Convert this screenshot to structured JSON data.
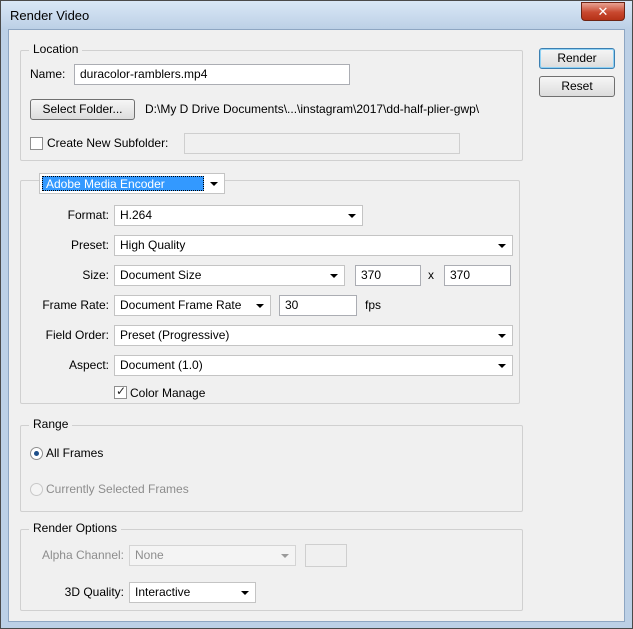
{
  "window": {
    "title": "Render Video",
    "close_glyph": "✕"
  },
  "buttons": {
    "render": "Render",
    "reset": "Reset",
    "select_folder": "Select Folder..."
  },
  "location": {
    "legend": "Location",
    "name_label": "Name:",
    "name_value": "duracolor-ramblers.mp4",
    "folder_path": "D:\\My D Drive Documents\\...\\instagram\\2017\\dd-half-plier-gwp\\",
    "create_subfolder_label": "Create New Subfolder:",
    "create_subfolder_checked": false,
    "subfolder_value": ""
  },
  "encoder": {
    "selected": "Adobe Media Encoder",
    "format_label": "Format:",
    "format_value": "H.264",
    "preset_label": "Preset:",
    "preset_value": "High Quality",
    "size_label": "Size:",
    "size_value": "Document Size",
    "width": "370",
    "size_x": "x",
    "height": "370",
    "frame_rate_label": "Frame Rate:",
    "frame_rate_value": "Document Frame Rate",
    "fps_value": "30",
    "fps_label": "fps",
    "field_order_label": "Field Order:",
    "field_order_value": "Preset (Progressive)",
    "aspect_label": "Aspect:",
    "aspect_value": "Document (1.0)",
    "color_manage_label": "Color Manage",
    "color_manage_checked": true
  },
  "range": {
    "legend": "Range",
    "all_frames": "All Frames",
    "selected_frames": "Currently Selected Frames",
    "selected": "All Frames"
  },
  "render_options": {
    "legend": "Render Options",
    "alpha_label": "Alpha Channel:",
    "alpha_value": "None",
    "quality_label": "3D Quality:",
    "quality_value": "Interactive"
  }
}
